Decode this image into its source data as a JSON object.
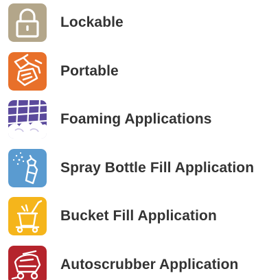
{
  "features": [
    {
      "label": "Lockable",
      "icon": "padlock-icon",
      "color": "#B3A68A"
    },
    {
      "label": "Portable",
      "icon": "portable-dispenser-icon",
      "color": "#E8702A"
    },
    {
      "label": "Foaming Applications",
      "icon": "foaming-tiles-icon",
      "color": "#5B4A9C"
    },
    {
      "label": "Spray Bottle Fill Application",
      "icon": "spray-bottle-icon",
      "color": "#5A9BD0"
    },
    {
      "label": "Bucket Fill Application",
      "icon": "bucket-cart-icon",
      "color": "#F5B51B"
    },
    {
      "label": "Autoscrubber Application",
      "icon": "autoscrubber-icon",
      "color": "#B5242C"
    }
  ]
}
